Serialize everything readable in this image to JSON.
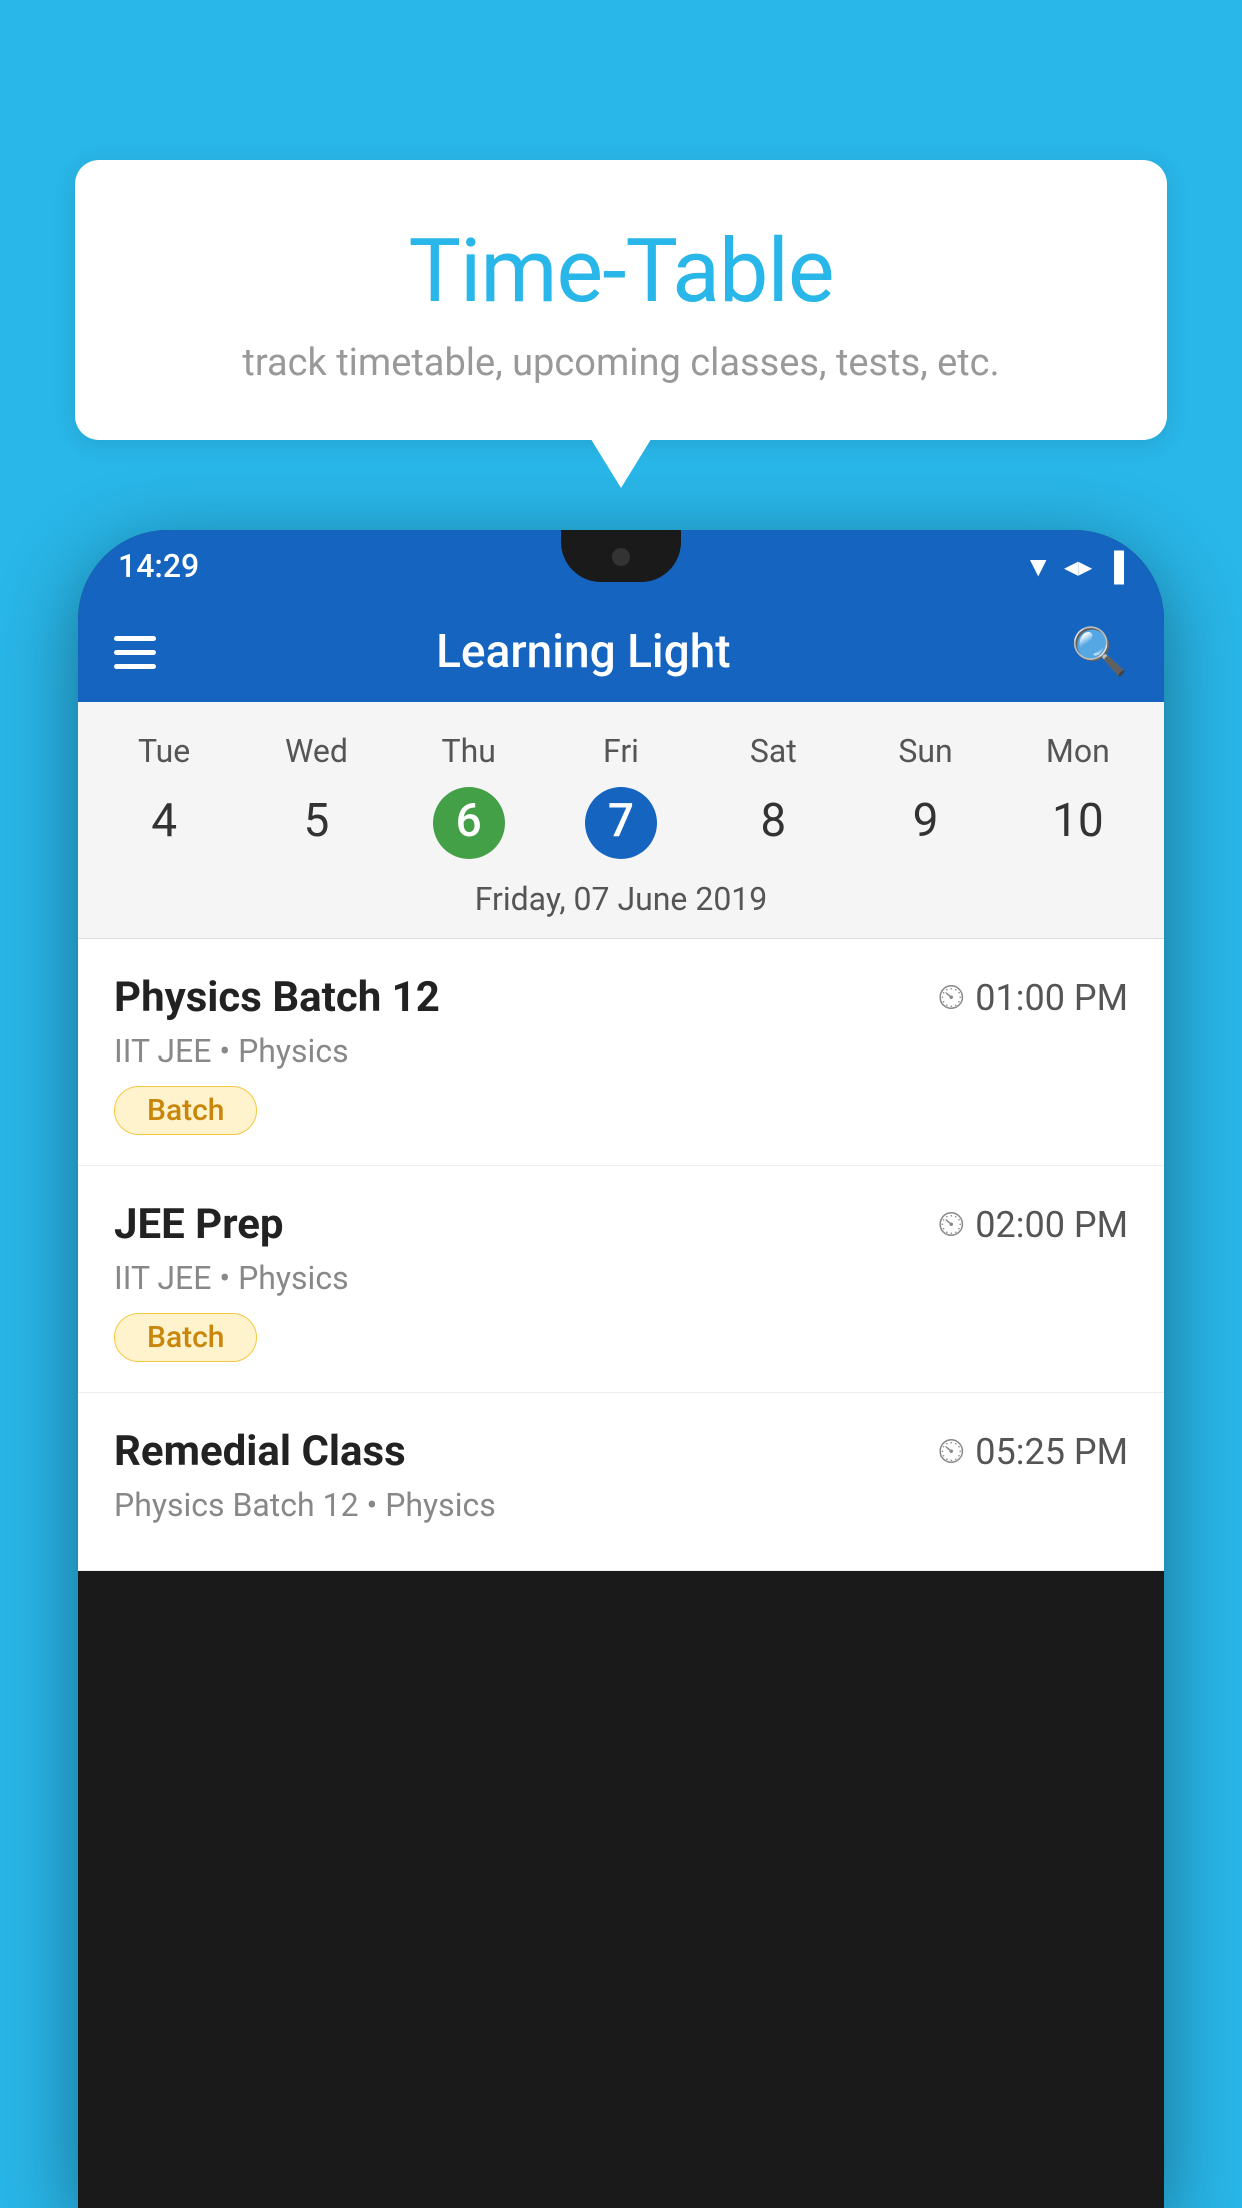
{
  "background_color": "#29B6E8",
  "tooltip": {
    "title": "Time-Table",
    "subtitle": "track timetable, upcoming classes, tests, etc."
  },
  "phone": {
    "status_bar": {
      "time": "14:29",
      "icons": [
        "▼",
        "◀",
        "▐"
      ]
    },
    "app_bar": {
      "title": "Learning Light",
      "search_label": "search"
    },
    "calendar": {
      "days": [
        "Tue",
        "Wed",
        "Thu",
        "Fri",
        "Sat",
        "Sun",
        "Mon"
      ],
      "numbers": [
        "4",
        "5",
        "6",
        "7",
        "8",
        "9",
        "10"
      ],
      "today_index": 2,
      "selected_index": 3,
      "selected_label": "Friday, 07 June 2019"
    },
    "classes": [
      {
        "name": "Physics Batch 12",
        "time": "01:00 PM",
        "meta": "IIT JEE • Physics",
        "tag": "Batch"
      },
      {
        "name": "JEE Prep",
        "time": "02:00 PM",
        "meta": "IIT JEE • Physics",
        "tag": "Batch"
      },
      {
        "name": "Remedial Class",
        "time": "05:25 PM",
        "meta": "Physics Batch 12 • Physics",
        "tag": null
      }
    ]
  }
}
